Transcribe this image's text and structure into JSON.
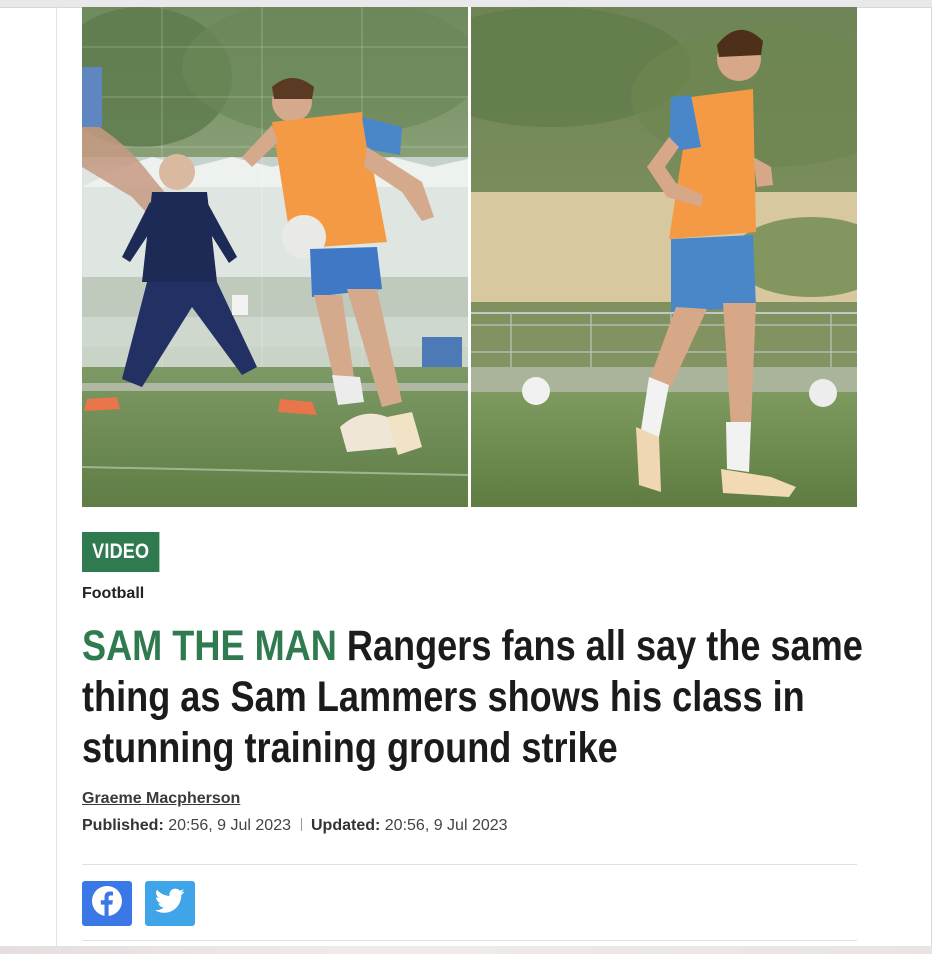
{
  "badge": {
    "label": "VIDEO"
  },
  "article": {
    "section": "Football",
    "headline_kicker": "SAM THE MAN",
    "headline_text": "Rangers fans all say the same thing as Sam Lammers shows his class in stunning training ground strike",
    "author": "Graeme Macpherson",
    "published_label": "Published:",
    "published_value": "20:56, 9 Jul 2023",
    "updated_label": "Updated:",
    "updated_value": "20:56, 9 Jul 2023"
  },
  "share": {
    "facebook_icon": "facebook-icon",
    "twitter_icon": "twitter-icon"
  },
  "colors": {
    "accent_green": "#2f7a4e",
    "facebook_blue": "#3b78e7",
    "twitter_blue": "#3fa4e8"
  }
}
